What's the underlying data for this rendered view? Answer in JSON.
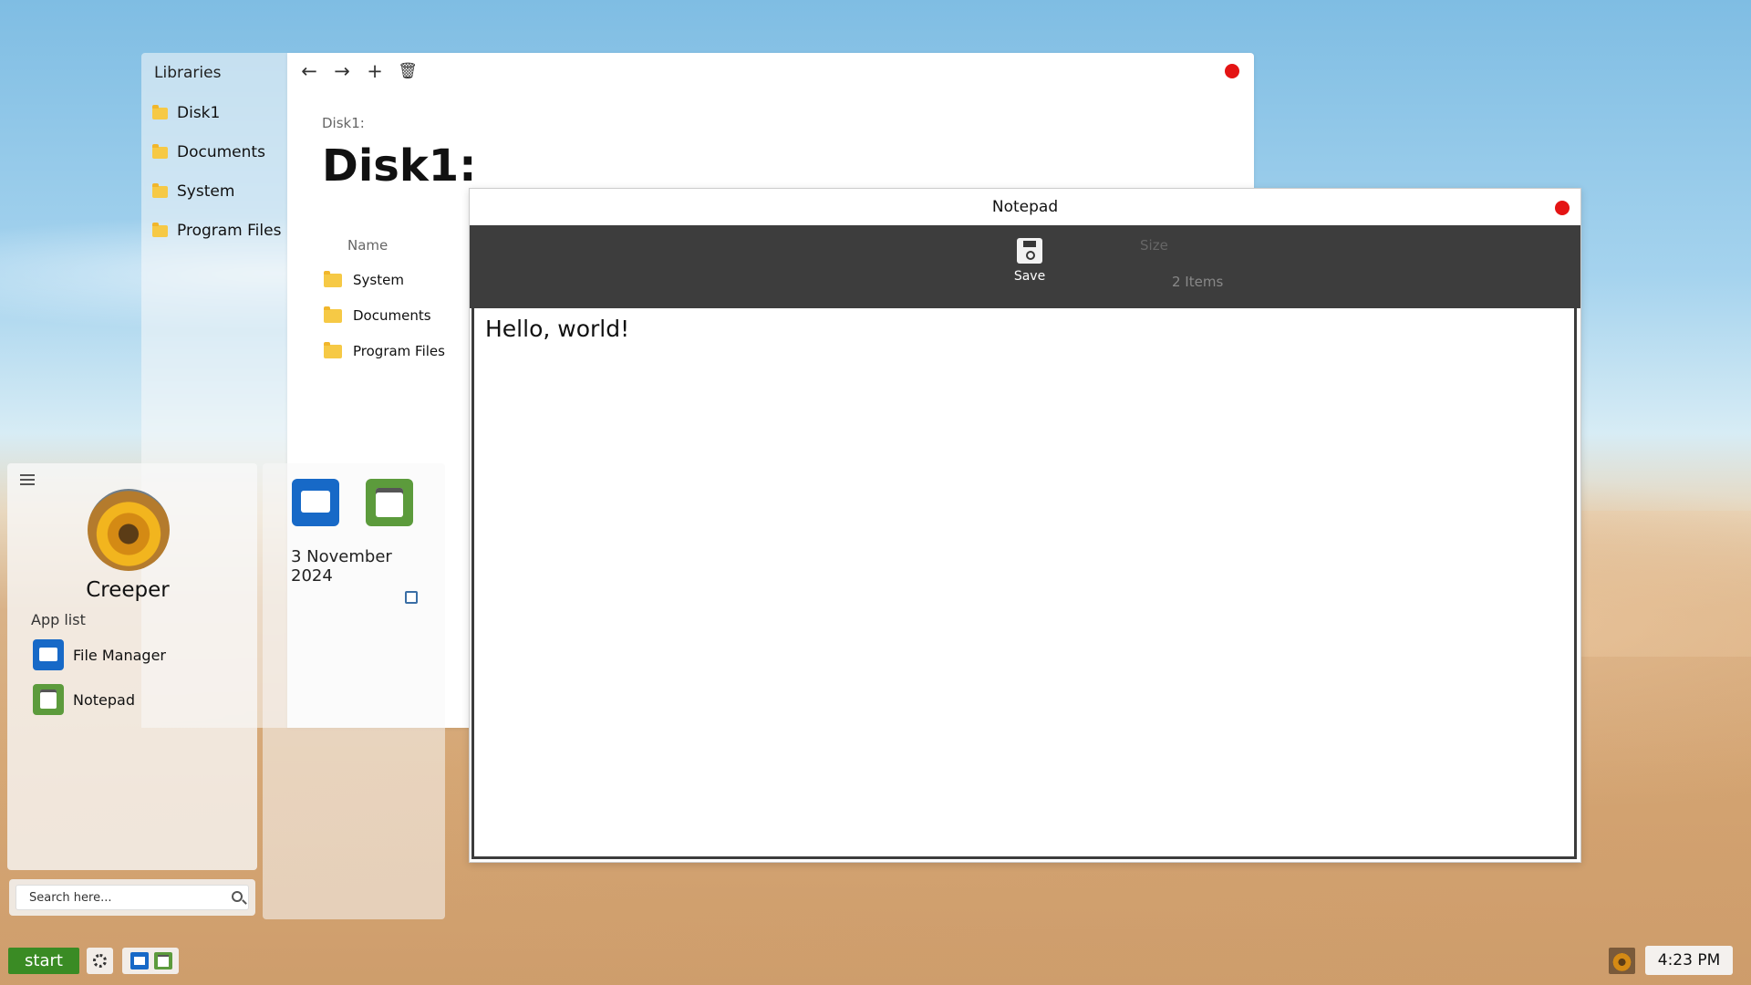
{
  "file_manager": {
    "sidebar_title": "Libraries",
    "libraries": [
      {
        "label": "Disk1",
        "icon": "folder-icon"
      },
      {
        "label": "Documents",
        "icon": "folder-icon"
      },
      {
        "label": "System",
        "icon": "folder-icon"
      },
      {
        "label": "Program Files",
        "icon": "folder-icon"
      }
    ],
    "toolbar": {
      "back_icon": "←",
      "forward_icon": "→",
      "new_icon": "+",
      "delete_icon": "🗑"
    },
    "breadcrumb": "Disk1:",
    "heading": "Disk1:",
    "columns": {
      "name": "Name",
      "size": "Size"
    },
    "items_count": "2 Items",
    "rows": [
      {
        "name": "System"
      },
      {
        "name": "Documents"
      },
      {
        "name": "Program Files"
      }
    ],
    "close_color": "#e41414"
  },
  "widget": {
    "date": "3 November 2024"
  },
  "start_menu": {
    "user_name": "Creeper",
    "app_list_label": "App list",
    "apps": [
      {
        "label": "File Manager",
        "icon": "file-manager-icon",
        "color": "#1769c7"
      },
      {
        "label": "Notepad",
        "icon": "notepad-icon",
        "color": "#5c9b3c"
      }
    ],
    "search_placeholder": "Search here..."
  },
  "notepad": {
    "title": "Notepad",
    "save_label": "Save",
    "content": "Hello, world!"
  },
  "taskbar": {
    "start_label": "start",
    "start_color": "#3a8b24",
    "clock": "4:23 PM"
  }
}
